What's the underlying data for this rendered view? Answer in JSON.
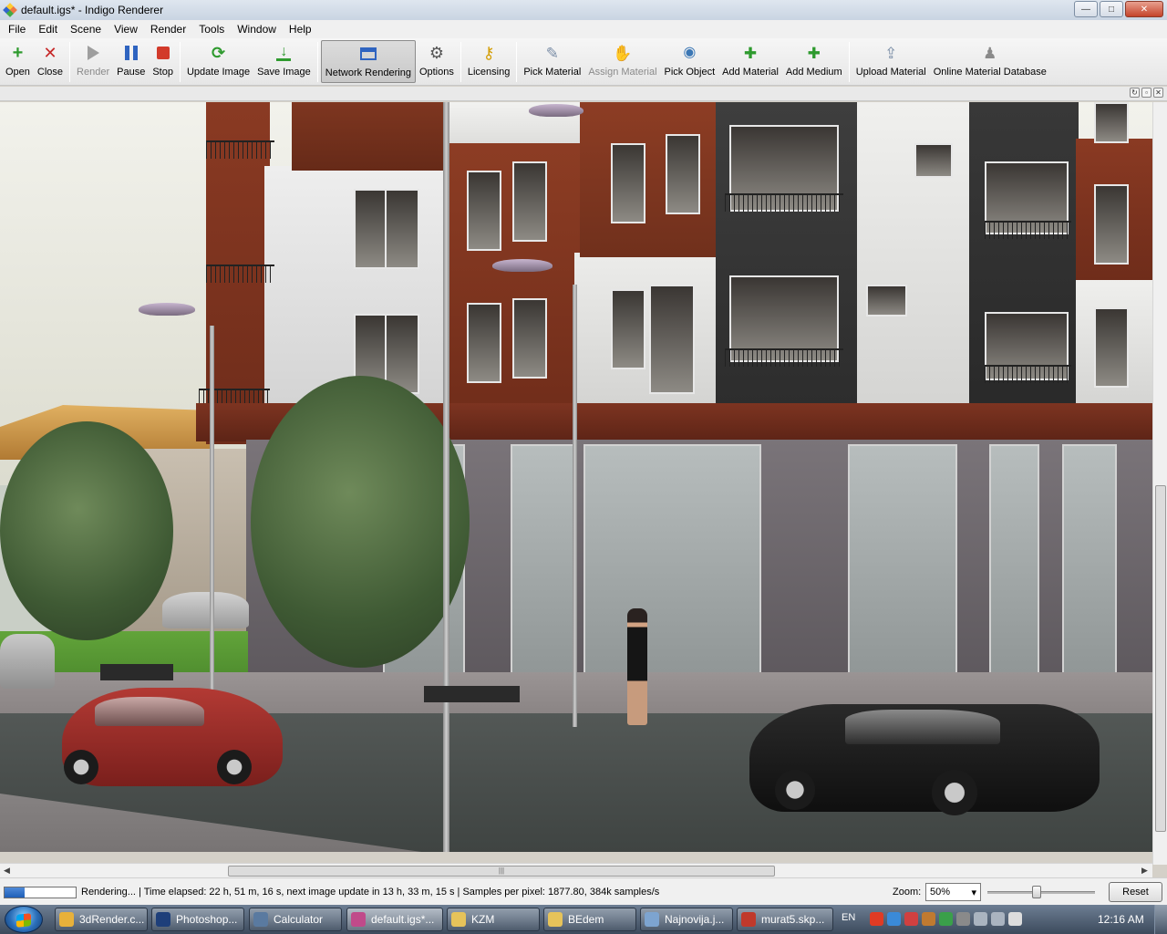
{
  "window": {
    "title": "default.igs* - Indigo Renderer",
    "controls": {
      "minimize": "—",
      "maximize": "□",
      "close": "✕"
    }
  },
  "menu": [
    "File",
    "Edit",
    "Scene",
    "View",
    "Render",
    "Tools",
    "Window",
    "Help"
  ],
  "toolbar": {
    "open": "Open",
    "close": "Close",
    "render": "Render",
    "pause": "Pause",
    "stop": "Stop",
    "update_image": "Update Image",
    "save_image": "Save Image",
    "network_rendering": "Network Rendering",
    "options": "Options",
    "licensing": "Licensing",
    "pick_material": "Pick Material",
    "assign_material": "Assign Material",
    "pick_object": "Pick Object",
    "add_material": "Add Material",
    "add_medium": "Add Medium",
    "upload_material": "Upload Material",
    "online_material_database": "Online Material Database"
  },
  "status": {
    "text": "Rendering... | Time elapsed: 22 h, 51 m, 16 s, next image update in 13 h, 33 m, 15 s | Samples per pixel: 1877.80, 384k samples/s",
    "progress_fraction": 0.28,
    "zoom_label": "Zoom:",
    "zoom_value": "50%",
    "zoom_slider_fraction": 0.45,
    "reset_label": "Reset"
  },
  "taskbar": {
    "items": [
      {
        "label": "3dRender.c...",
        "color": "#e8b13a"
      },
      {
        "label": "Photoshop...",
        "color": "#1e3f7a"
      },
      {
        "label": "Calculator",
        "color": "#5a7aa0"
      },
      {
        "label": "default.igs*...",
        "color": "#c04a8a"
      },
      {
        "label": "KZM",
        "color": "#e6c35a"
      },
      {
        "label": "BEdem",
        "color": "#e6c35a"
      },
      {
        "label": "Najnovija.j...",
        "color": "#7da4d0"
      },
      {
        "label": "murat5.skp...",
        "color": "#c0392b"
      }
    ],
    "language": "EN",
    "clock": "12:16 AM",
    "tray_colors": [
      "#e03b24",
      "#3a8ad8",
      "#d04040",
      "#c07a30",
      "#3aa04a",
      "#8a8a8a",
      "#aab4c0",
      "#aab4c0",
      "#dddddd"
    ]
  },
  "colors": {
    "accent": "#2f64c0",
    "progress": "#1f5fb8"
  }
}
